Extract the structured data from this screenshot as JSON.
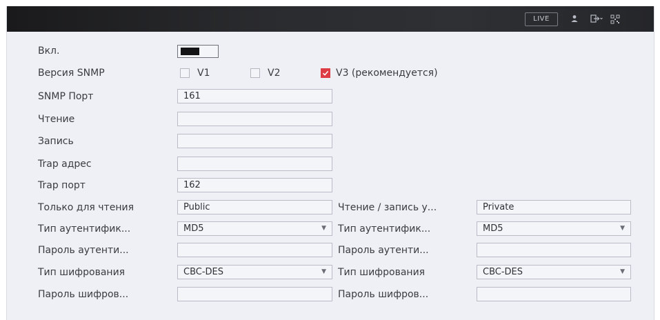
{
  "topbar": {
    "live_label": "LIVE",
    "icons": [
      "user-icon",
      "logout-icon",
      "qr-code-icon"
    ]
  },
  "form": {
    "enable": {
      "label": "Вкл.",
      "on": true
    },
    "snmp_version": {
      "label": "Версия SNMP",
      "options": [
        {
          "label": "V1",
          "checked": false
        },
        {
          "label": "V2",
          "checked": false
        },
        {
          "label": "V3 (рекомендуется)",
          "checked": true
        }
      ]
    },
    "snmp_port": {
      "label": "SNMP Порт",
      "value": "161"
    },
    "read": {
      "label": "Чтение",
      "value": ""
    },
    "write": {
      "label": "Запись",
      "value": ""
    },
    "trap_address": {
      "label": "Trap адрес",
      "value": ""
    },
    "trap_port": {
      "label": "Trap порт",
      "value": "162"
    },
    "left": {
      "user": {
        "label": "Только для чтения",
        "value": "Public"
      },
      "auth_type": {
        "label": "Тип аутентифик...",
        "value": "MD5"
      },
      "auth_password": {
        "label": "Пароль аутенти...",
        "value": ""
      },
      "encryption_type": {
        "label": "Тип шифрования",
        "value": "CBC-DES"
      },
      "encryption_password": {
        "label": "Пароль шифров...",
        "value": ""
      }
    },
    "right": {
      "user": {
        "label": "Чтение / запись у...",
        "value": "Private"
      },
      "auth_type": {
        "label": "Тип аутентифик...",
        "value": "MD5"
      },
      "auth_password": {
        "label": "Пароль аутенти...",
        "value": ""
      },
      "encryption_type": {
        "label": "Тип шифрования",
        "value": "CBC-DES"
      },
      "encryption_password": {
        "label": "Пароль шифров...",
        "value": ""
      }
    }
  },
  "colors": {
    "panel_bg": "#eef0f6",
    "topbar_bg": "#1e1f22",
    "check_accent": "#dd3c44",
    "field_border": "#b9bcc7"
  }
}
